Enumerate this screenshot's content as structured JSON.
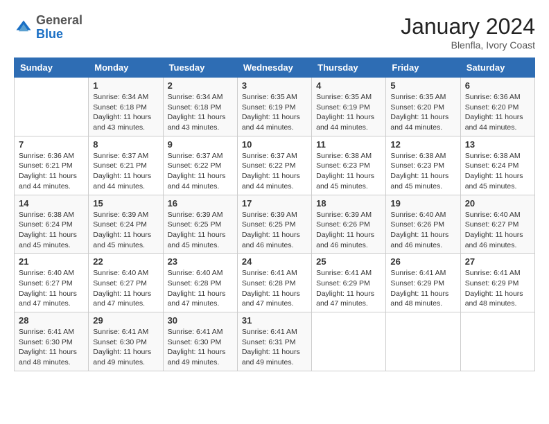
{
  "header": {
    "logo_general": "General",
    "logo_blue": "Blue",
    "month_year": "January 2024",
    "location": "Blenfla, Ivory Coast"
  },
  "days_of_week": [
    "Sunday",
    "Monday",
    "Tuesday",
    "Wednesday",
    "Thursday",
    "Friday",
    "Saturday"
  ],
  "weeks": [
    [
      {
        "day": "",
        "sunrise": "",
        "sunset": "",
        "daylight": ""
      },
      {
        "day": "1",
        "sunrise": "Sunrise: 6:34 AM",
        "sunset": "Sunset: 6:18 PM",
        "daylight": "Daylight: 11 hours and 43 minutes."
      },
      {
        "day": "2",
        "sunrise": "Sunrise: 6:34 AM",
        "sunset": "Sunset: 6:18 PM",
        "daylight": "Daylight: 11 hours and 43 minutes."
      },
      {
        "day": "3",
        "sunrise": "Sunrise: 6:35 AM",
        "sunset": "Sunset: 6:19 PM",
        "daylight": "Daylight: 11 hours and 44 minutes."
      },
      {
        "day": "4",
        "sunrise": "Sunrise: 6:35 AM",
        "sunset": "Sunset: 6:19 PM",
        "daylight": "Daylight: 11 hours and 44 minutes."
      },
      {
        "day": "5",
        "sunrise": "Sunrise: 6:35 AM",
        "sunset": "Sunset: 6:20 PM",
        "daylight": "Daylight: 11 hours and 44 minutes."
      },
      {
        "day": "6",
        "sunrise": "Sunrise: 6:36 AM",
        "sunset": "Sunset: 6:20 PM",
        "daylight": "Daylight: 11 hours and 44 minutes."
      }
    ],
    [
      {
        "day": "7",
        "sunrise": "Sunrise: 6:36 AM",
        "sunset": "Sunset: 6:21 PM",
        "daylight": "Daylight: 11 hours and 44 minutes."
      },
      {
        "day": "8",
        "sunrise": "Sunrise: 6:37 AM",
        "sunset": "Sunset: 6:21 PM",
        "daylight": "Daylight: 11 hours and 44 minutes."
      },
      {
        "day": "9",
        "sunrise": "Sunrise: 6:37 AM",
        "sunset": "Sunset: 6:22 PM",
        "daylight": "Daylight: 11 hours and 44 minutes."
      },
      {
        "day": "10",
        "sunrise": "Sunrise: 6:37 AM",
        "sunset": "Sunset: 6:22 PM",
        "daylight": "Daylight: 11 hours and 44 minutes."
      },
      {
        "day": "11",
        "sunrise": "Sunrise: 6:38 AM",
        "sunset": "Sunset: 6:23 PM",
        "daylight": "Daylight: 11 hours and 45 minutes."
      },
      {
        "day": "12",
        "sunrise": "Sunrise: 6:38 AM",
        "sunset": "Sunset: 6:23 PM",
        "daylight": "Daylight: 11 hours and 45 minutes."
      },
      {
        "day": "13",
        "sunrise": "Sunrise: 6:38 AM",
        "sunset": "Sunset: 6:24 PM",
        "daylight": "Daylight: 11 hours and 45 minutes."
      }
    ],
    [
      {
        "day": "14",
        "sunrise": "Sunrise: 6:38 AM",
        "sunset": "Sunset: 6:24 PM",
        "daylight": "Daylight: 11 hours and 45 minutes."
      },
      {
        "day": "15",
        "sunrise": "Sunrise: 6:39 AM",
        "sunset": "Sunset: 6:24 PM",
        "daylight": "Daylight: 11 hours and 45 minutes."
      },
      {
        "day": "16",
        "sunrise": "Sunrise: 6:39 AM",
        "sunset": "Sunset: 6:25 PM",
        "daylight": "Daylight: 11 hours and 45 minutes."
      },
      {
        "day": "17",
        "sunrise": "Sunrise: 6:39 AM",
        "sunset": "Sunset: 6:25 PM",
        "daylight": "Daylight: 11 hours and 46 minutes."
      },
      {
        "day": "18",
        "sunrise": "Sunrise: 6:39 AM",
        "sunset": "Sunset: 6:26 PM",
        "daylight": "Daylight: 11 hours and 46 minutes."
      },
      {
        "day": "19",
        "sunrise": "Sunrise: 6:40 AM",
        "sunset": "Sunset: 6:26 PM",
        "daylight": "Daylight: 11 hours and 46 minutes."
      },
      {
        "day": "20",
        "sunrise": "Sunrise: 6:40 AM",
        "sunset": "Sunset: 6:27 PM",
        "daylight": "Daylight: 11 hours and 46 minutes."
      }
    ],
    [
      {
        "day": "21",
        "sunrise": "Sunrise: 6:40 AM",
        "sunset": "Sunset: 6:27 PM",
        "daylight": "Daylight: 11 hours and 47 minutes."
      },
      {
        "day": "22",
        "sunrise": "Sunrise: 6:40 AM",
        "sunset": "Sunset: 6:27 PM",
        "daylight": "Daylight: 11 hours and 47 minutes."
      },
      {
        "day": "23",
        "sunrise": "Sunrise: 6:40 AM",
        "sunset": "Sunset: 6:28 PM",
        "daylight": "Daylight: 11 hours and 47 minutes."
      },
      {
        "day": "24",
        "sunrise": "Sunrise: 6:41 AM",
        "sunset": "Sunset: 6:28 PM",
        "daylight": "Daylight: 11 hours and 47 minutes."
      },
      {
        "day": "25",
        "sunrise": "Sunrise: 6:41 AM",
        "sunset": "Sunset: 6:29 PM",
        "daylight": "Daylight: 11 hours and 47 minutes."
      },
      {
        "day": "26",
        "sunrise": "Sunrise: 6:41 AM",
        "sunset": "Sunset: 6:29 PM",
        "daylight": "Daylight: 11 hours and 48 minutes."
      },
      {
        "day": "27",
        "sunrise": "Sunrise: 6:41 AM",
        "sunset": "Sunset: 6:29 PM",
        "daylight": "Daylight: 11 hours and 48 minutes."
      }
    ],
    [
      {
        "day": "28",
        "sunrise": "Sunrise: 6:41 AM",
        "sunset": "Sunset: 6:30 PM",
        "daylight": "Daylight: 11 hours and 48 minutes."
      },
      {
        "day": "29",
        "sunrise": "Sunrise: 6:41 AM",
        "sunset": "Sunset: 6:30 PM",
        "daylight": "Daylight: 11 hours and 49 minutes."
      },
      {
        "day": "30",
        "sunrise": "Sunrise: 6:41 AM",
        "sunset": "Sunset: 6:30 PM",
        "daylight": "Daylight: 11 hours and 49 minutes."
      },
      {
        "day": "31",
        "sunrise": "Sunrise: 6:41 AM",
        "sunset": "Sunset: 6:31 PM",
        "daylight": "Daylight: 11 hours and 49 minutes."
      },
      {
        "day": "",
        "sunrise": "",
        "sunset": "",
        "daylight": ""
      },
      {
        "day": "",
        "sunrise": "",
        "sunset": "",
        "daylight": ""
      },
      {
        "day": "",
        "sunrise": "",
        "sunset": "",
        "daylight": ""
      }
    ]
  ]
}
